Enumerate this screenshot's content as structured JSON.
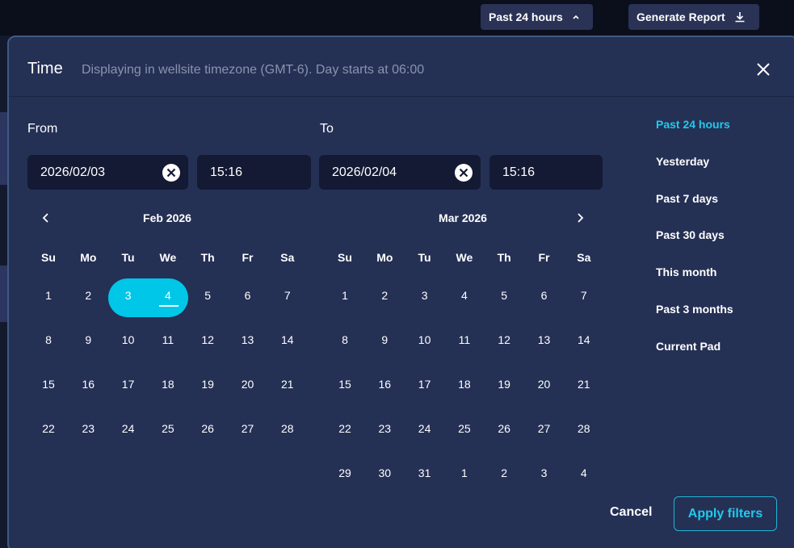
{
  "topbar": {
    "range_label": "Past 24 hours",
    "report_label": "Generate Report"
  },
  "modal": {
    "title": "Time",
    "subtitle": "Displaying in wellsite timezone (GMT-6). Day starts at 06:00"
  },
  "from": {
    "label": "From",
    "date": "2026/02/03",
    "time": "15:16"
  },
  "to": {
    "label": "To",
    "date": "2026/02/04",
    "time": "15:16"
  },
  "calendar": {
    "weekdays": [
      "Su",
      "Mo",
      "Tu",
      "We",
      "Th",
      "Fr",
      "Sa"
    ],
    "left": {
      "title": "Feb 2026",
      "weeks": [
        [
          "1",
          "2",
          "3",
          "4",
          "5",
          "6",
          "7"
        ],
        [
          "8",
          "9",
          "10",
          "11",
          "12",
          "13",
          "14"
        ],
        [
          "15",
          "16",
          "17",
          "18",
          "19",
          "20",
          "21"
        ],
        [
          "22",
          "23",
          "24",
          "25",
          "26",
          "27",
          "28"
        ]
      ]
    },
    "right": {
      "title": "Mar 2026",
      "weeks": [
        [
          "1",
          "2",
          "3",
          "4",
          "5",
          "6",
          "7"
        ],
        [
          "8",
          "9",
          "10",
          "11",
          "12",
          "13",
          "14"
        ],
        [
          "15",
          "16",
          "17",
          "18",
          "19",
          "20",
          "21"
        ],
        [
          "22",
          "23",
          "24",
          "25",
          "26",
          "27",
          "28"
        ],
        [
          "29",
          "30",
          "31",
          "1",
          "2",
          "3",
          "4"
        ]
      ]
    },
    "selected_range": [
      "3",
      "4"
    ]
  },
  "presets": [
    "Past 24 hours",
    "Yesterday",
    "Past 7 days",
    "Past 30 days",
    "This month",
    "Past 3 months",
    "Current Pad"
  ],
  "active_preset": "Past 24 hours",
  "actions": {
    "cancel": "Cancel",
    "apply": "Apply filters"
  },
  "colors": {
    "accent": "#00c6e8",
    "modal_bg": "#253055",
    "input_bg": "#141a34",
    "page_bg": "#0b0f1c"
  }
}
